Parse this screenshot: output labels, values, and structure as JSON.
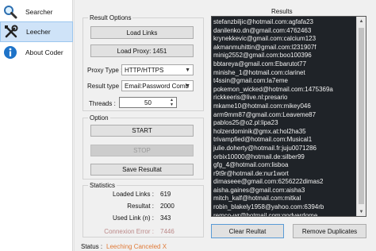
{
  "sidebar": {
    "items": [
      {
        "label": "Searcher",
        "icon": "magnifier-icon"
      },
      {
        "label": "Leecher",
        "icon": "tools-icon"
      },
      {
        "label": "About Coder",
        "icon": "info-icon"
      }
    ]
  },
  "result_options": {
    "title": "Result Options",
    "load_links": "Load Links",
    "load_proxy": "Load Proxy: 1451",
    "proxy_type_label": "Proxy Type :",
    "proxy_type_value": "HTTP/HTTPS",
    "result_type_label": "Result type :",
    "result_type_value": "Email:Password Comb",
    "threads_label": "Threads :",
    "threads_value": "50"
  },
  "option": {
    "title": "Option",
    "start": "START",
    "stop": "STOP",
    "save": "Save Resultat"
  },
  "statistics": {
    "title": "Statistics",
    "rows": [
      {
        "label": "Loaded Links :",
        "value": "619"
      },
      {
        "label": "Resultat :",
        "value": "2000"
      },
      {
        "label": "Used Link (n) :",
        "value": "343"
      },
      {
        "label": "Connexion Error :",
        "value": "7446"
      }
    ]
  },
  "results": {
    "title": "Results",
    "lines": [
      "stefanzbiljic@hotmail.com:agfafa23",
      "danilenko.dn@gmail.com:4762463",
      "krynekkevic@gmail.com:calcium123",
      "akmanmuhittin@gmail.com:l231907f",
      "minig2552@gmail.com:boo100396",
      "bbtareya@gmail.com:Ebarutot77",
      "minishe_1@hotmail.com:clarinet",
      "t4ssin@gmail.com:la7eme",
      "pokemon_wicked@hotmail.com:1475369a",
      "rickkeeris@live.nl:presario",
      "mkame10@hotmail.com:mikey046",
      "arm9mm87@gmail.com:Leaveme87",
      "pablos25@o2.pl:lipa23",
      "holzerdominik@gmx.at:hol2ha35",
      "trivampfied@hotmail.com:Musical1",
      "julie.doherty@hotmail.fr:juju0071286",
      "orbix10000@hotmail.de:silber99",
      "gfg_4@hotmail.com:lisboa",
      "r9t9r@hotmail.de:nur1wort",
      "dimaseee@gmail.com:6256222dimas2",
      "aisha.gaines@gmail.com:aisha3",
      "mitch_kalf@hotmail.com:mitkal",
      "robin_blakely1958@yahoo.com:6394rb",
      "remco-wr@hotmail.com:godverdome",
      "juanantonio_decai10@hotmail.com:defensa",
      "juanantonio_decai10@hotmail.com:defensa"
    ],
    "clear": "Clear Reultat",
    "remove_duplicates": "Remove Duplicates"
  },
  "status": {
    "label": "Status :",
    "value": "Leeching Canceled X"
  },
  "colors": {
    "status_value": "#e07b39",
    "results_bg": "#1f2328",
    "active_nav": "#cfe3f8"
  }
}
